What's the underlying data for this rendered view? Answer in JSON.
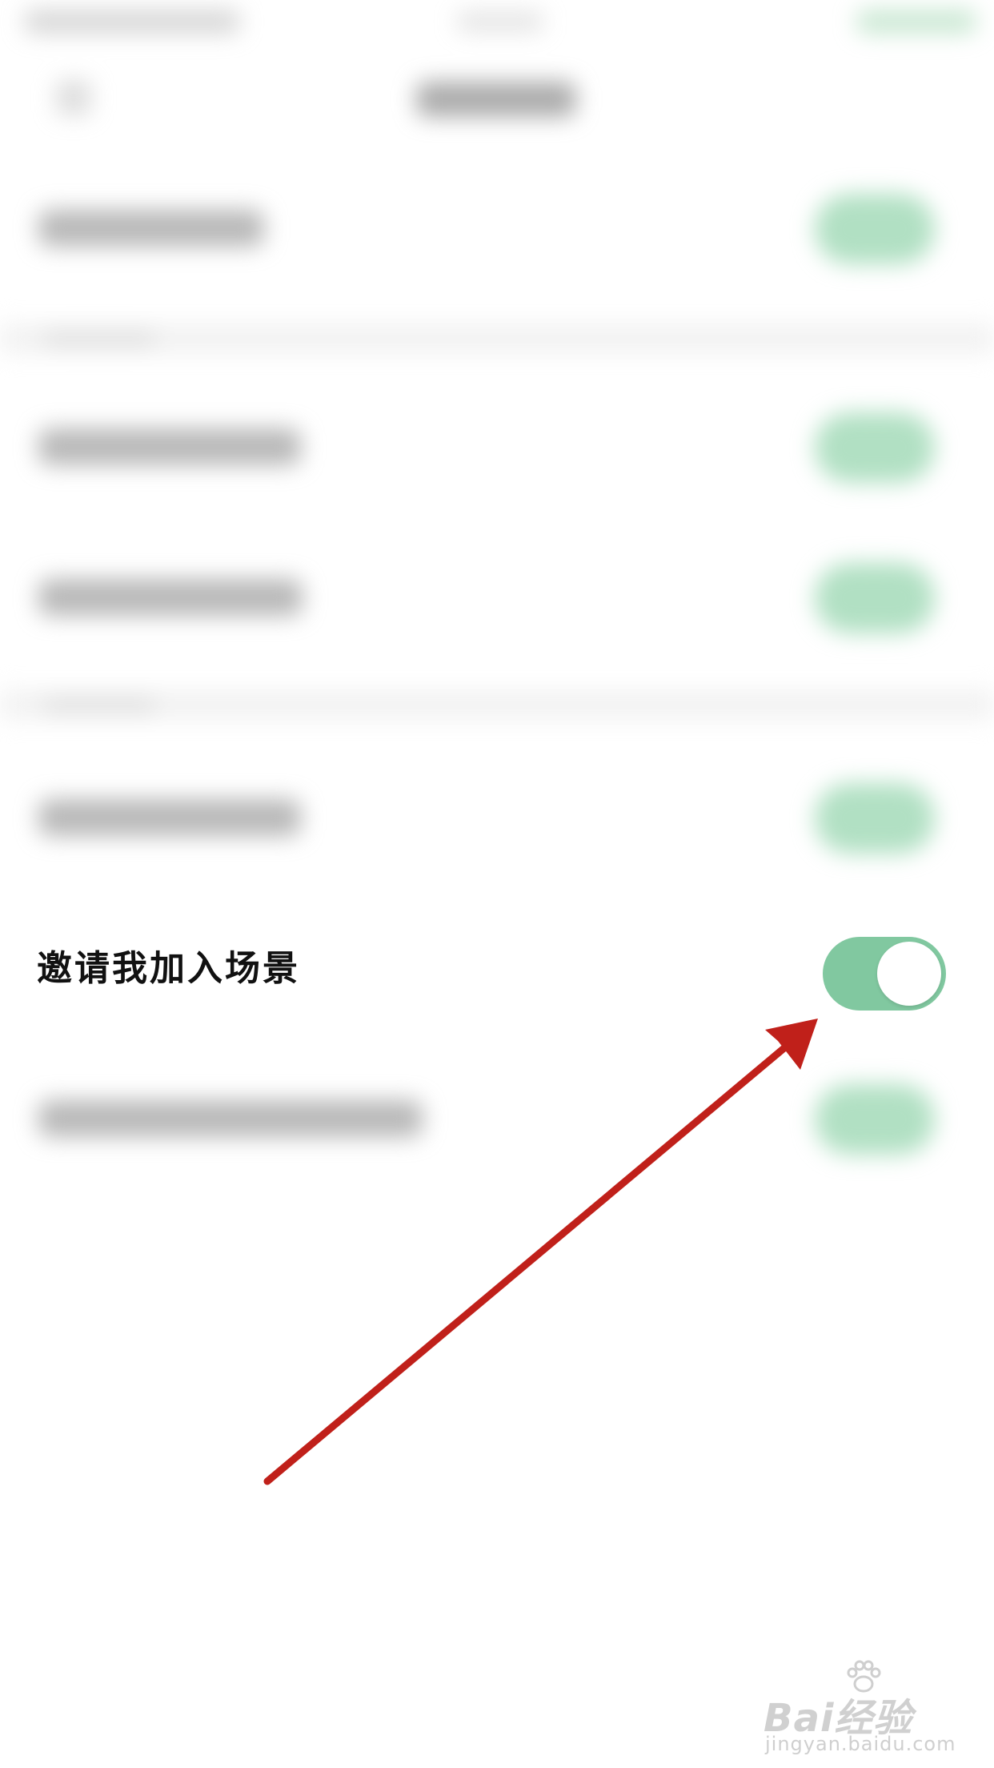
{
  "settings": {
    "visible_row": {
      "label": "邀请我加入场景",
      "toggle_state": "on",
      "toggle_color": "#81C8A0"
    }
  },
  "annotation": {
    "arrow_color": "#C0201A"
  },
  "watermark": {
    "main": "Bai经验",
    "sub": "jingyan.baidu.com"
  }
}
